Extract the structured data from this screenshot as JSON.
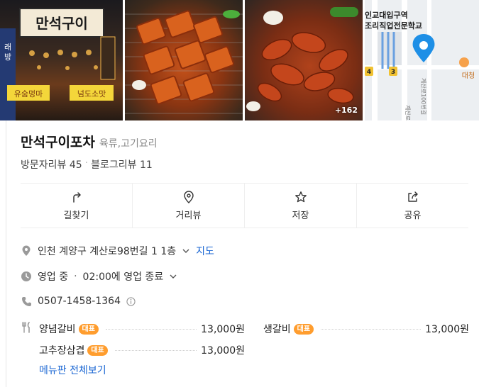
{
  "gallery": {
    "photo1_sign": "만석구이",
    "photo1_banner_left": "유숨멍마",
    "photo1_banner_right": "넘도소맛",
    "more_count": "+162",
    "map_station": "인교대입구역",
    "map_school": "조리직업전문학교",
    "map_line4": "4",
    "map_line3": "3",
    "map_street1": "계산로98번길",
    "map_street2": "계산로100번길",
    "map_poi": "대청"
  },
  "place": {
    "name": "만석구이포차",
    "category": "육류,고기요리",
    "visitor_reviews": "방문자리뷰 45",
    "blog_reviews": "블로그리뷰 11"
  },
  "actions": [
    {
      "label": "길찾기",
      "icon": "directions-icon"
    },
    {
      "label": "거리뷰",
      "icon": "streetview-icon"
    },
    {
      "label": "저장",
      "icon": "star-icon"
    },
    {
      "label": "공유",
      "icon": "share-icon"
    }
  ],
  "info": {
    "address": "인천 계양구 계산로98번길 1 1층",
    "map_link": "지도",
    "status": "영업 중",
    "hours": "02:00에 영업 종료",
    "phone": "0507-1458-1364"
  },
  "menu": {
    "items": [
      {
        "name": "양념갈비",
        "badge": "대표",
        "price": "13,000원"
      },
      {
        "name": "생갈비",
        "badge": "대표",
        "price": "13,000원"
      },
      {
        "name": "고추장삼겹",
        "badge": "대표",
        "price": "13,000원"
      }
    ],
    "see_all": "메뉴판 전체보기"
  },
  "colors": {
    "accent": "#1a66d3",
    "badge": "#ff9d2e",
    "map_pin": "#1e8fe6"
  }
}
